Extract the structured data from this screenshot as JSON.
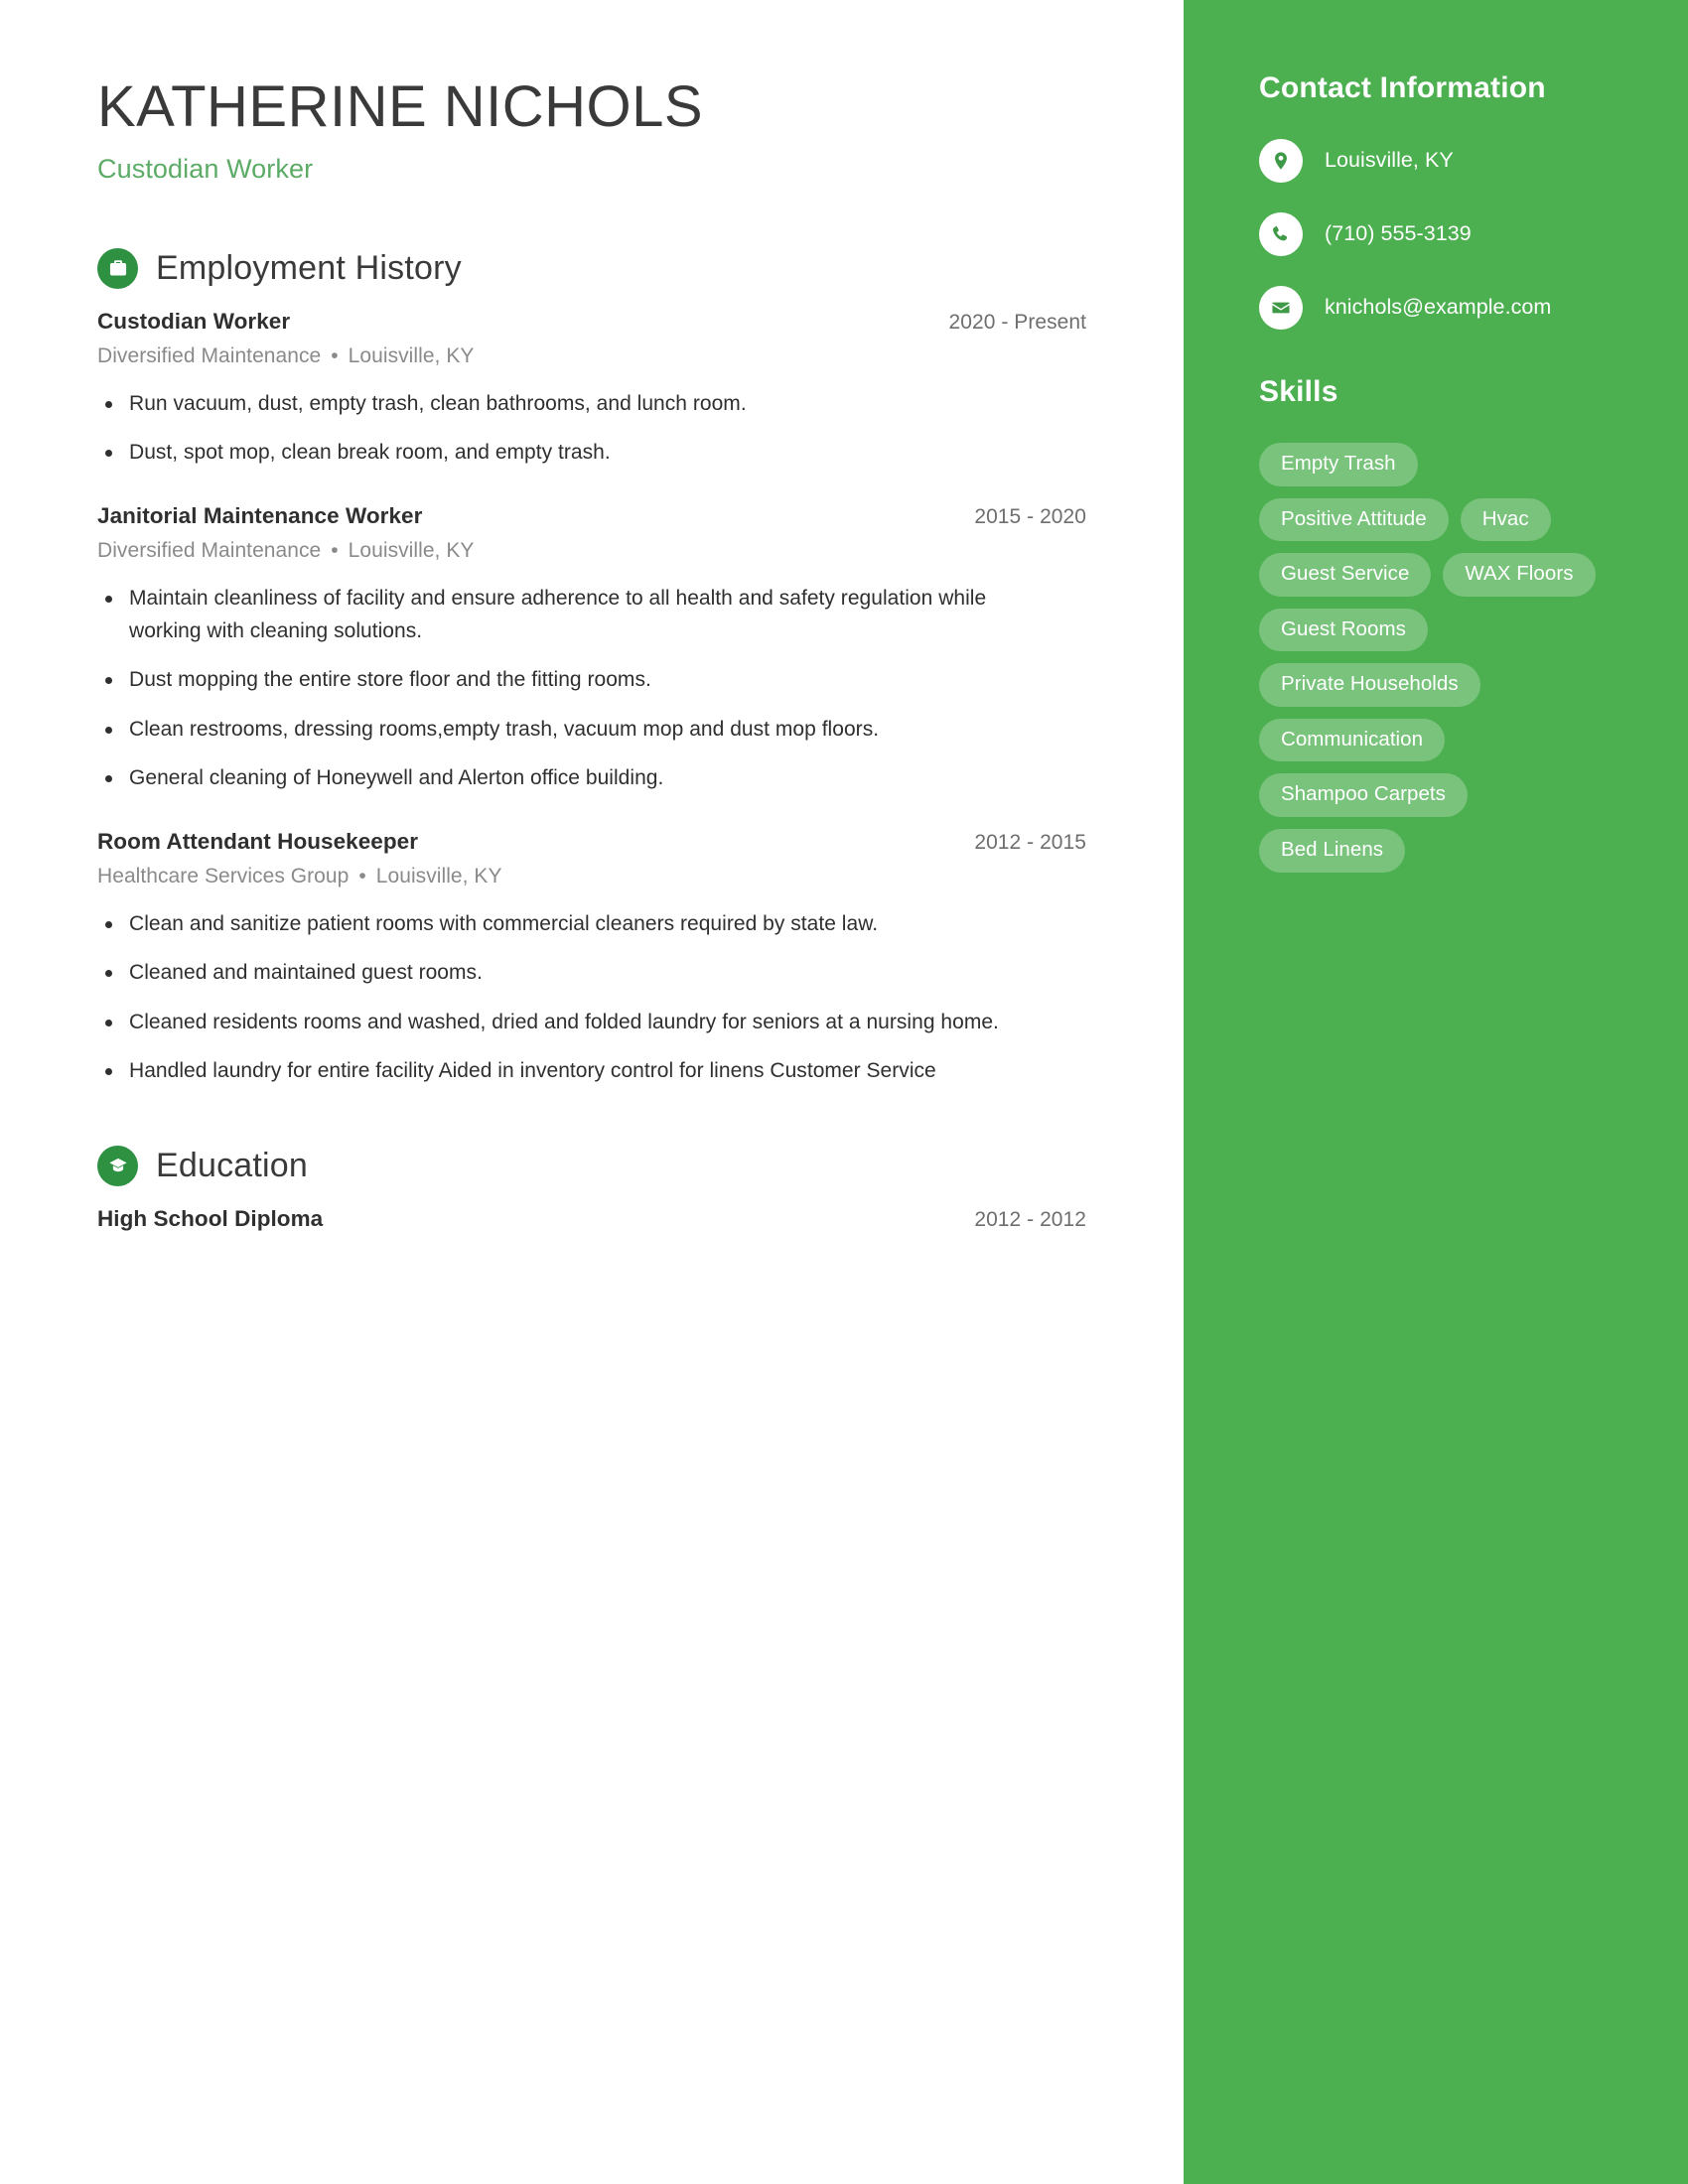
{
  "header": {
    "name": "KATHERINE NICHOLS",
    "job_title": "Custodian Worker"
  },
  "sections": {
    "employment_title": "Employment History",
    "employment_icon": "briefcase-icon",
    "education_title": "Education",
    "education_icon": "graduation-cap-icon"
  },
  "employment": [
    {
      "title": "Custodian Worker",
      "date": "2020 - Present",
      "company": "Diversified Maintenance",
      "separator": "•",
      "location": "Louisville, KY",
      "bullets": [
        "Run vacuum, dust, empty trash, clean bathrooms, and lunch room.",
        "Dust, spot mop, clean break room, and empty trash."
      ]
    },
    {
      "title": "Janitorial Maintenance Worker",
      "date": "2015 - 2020",
      "company": "Diversified Maintenance",
      "separator": "•",
      "location": "Louisville, KY",
      "bullets": [
        "Maintain cleanliness of facility and ensure adherence to all health and safety regulation while working with cleaning solutions.",
        "Dust mopping the entire store floor and the fitting rooms.",
        "Clean restrooms, dressing rooms,empty trash, vacuum mop and dust mop floors.",
        "General cleaning of Honeywell and Alerton office building."
      ]
    },
    {
      "title": "Room Attendant Housekeeper",
      "date": "2012 - 2015",
      "company": "Healthcare Services Group",
      "separator": "•",
      "location": "Louisville, KY",
      "bullets": [
        "Clean and sanitize patient rooms with commercial cleaners required by state law.",
        "Cleaned and maintained guest rooms.",
        "Cleaned residents rooms and washed, dried and folded laundry for seniors at a nursing home.",
        "Handled laundry for entire facility Aided in inventory control for linens Customer Service"
      ]
    }
  ],
  "education": [
    {
      "title": "High School Diploma",
      "date": "2012 - 2012"
    }
  ],
  "sidebar": {
    "contact_heading": "Contact Information",
    "contacts": [
      {
        "icon": "location-pin-icon",
        "text": "Louisville, KY"
      },
      {
        "icon": "phone-icon",
        "text": "(710) 555-3139"
      },
      {
        "icon": "envelope-icon",
        "text": "knichols@example.com"
      }
    ],
    "skills_heading": "Skills",
    "skills": [
      "Empty Trash",
      "Positive Attitude",
      "Hvac",
      "Guest Service",
      "WAX Floors",
      "Guest Rooms",
      "Private Households",
      "Communication",
      "Shampoo Carpets",
      "Bed Linens"
    ]
  },
  "colors": {
    "sidebar_green": "#4caf50",
    "icon_green": "#2e9142",
    "subtitle_green": "#5cab66",
    "heading_dark": "#3a3a3a",
    "body_text": "#2f2f2f",
    "meta_text": "#8a8a8a",
    "date_text": "#6e6e6e",
    "pill_bg": "rgba(255,255,255,0.25)"
  }
}
